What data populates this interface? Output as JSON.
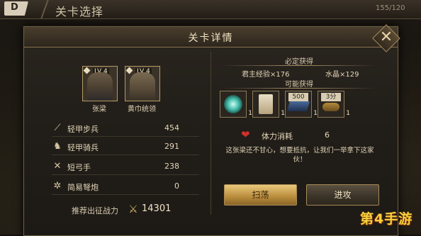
{
  "topbar": {
    "back_label": "D",
    "title": "关卡选择",
    "count": "155/120"
  },
  "dialog": {
    "title": "关卡详情",
    "close_label": "✕"
  },
  "heroes": [
    {
      "name": "张梁",
      "level": "LV 4"
    },
    {
      "name": "黄巾统领",
      "level": "LV 4"
    }
  ],
  "units": [
    {
      "icon": "spear-icon",
      "name": "轻甲步兵",
      "count": "454"
    },
    {
      "icon": "horse-icon",
      "name": "轻甲骑兵",
      "count": "291"
    },
    {
      "icon": "bow-icon",
      "name": "短弓手",
      "count": "238"
    },
    {
      "icon": "catapult-icon",
      "name": "简易弩炮",
      "count": "0"
    }
  ],
  "power": {
    "label": "推荐出征战力",
    "icon": "crossed-swords-icon",
    "value": "14301"
  },
  "rewards": {
    "guaranteed_title": "必定获得",
    "exp": "君主经验×176",
    "crystal": "水晶×129",
    "possible_title": "可能获得",
    "items": [
      {
        "icon": "orb-icon",
        "count": "1"
      },
      {
        "icon": "scroll-icon",
        "count": "1"
      },
      {
        "icon": "blue-gem-icon",
        "tag": "500",
        "count": "1"
      },
      {
        "icon": "gold-icon",
        "tag": "3分",
        "count": "1"
      }
    ]
  },
  "stamina": {
    "icon": "heart-icon",
    "label": "体力消耗",
    "value": "6"
  },
  "quote": "这张梁还不甘心，想要抵抗，让我们一举拿下这家伙！",
  "buttons": {
    "sweep": "扫荡",
    "attack": "进攻"
  },
  "watermark": "第4手游",
  "colors": {
    "accent_gold": "#e9c87a",
    "heart_red": "#d0302a",
    "watermark_yellow": "#f2d23a"
  }
}
